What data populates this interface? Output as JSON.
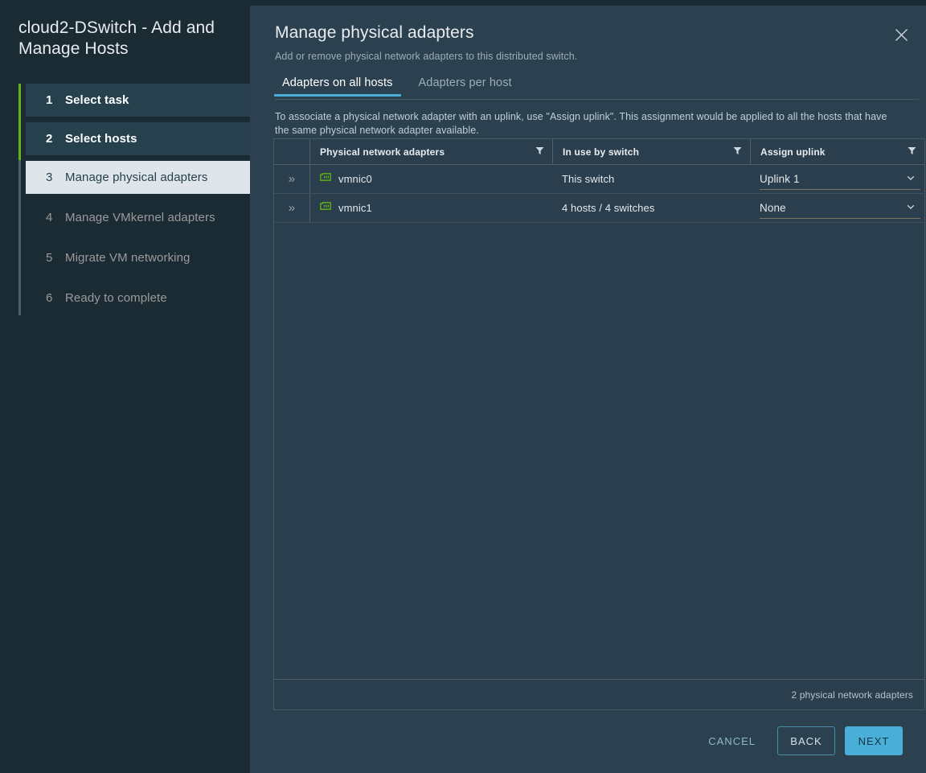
{
  "wizard": {
    "title": "cloud2-DSwitch - Add and Manage Hosts",
    "rail_done_color": "#60b515",
    "rail_color": "#4d5f6b",
    "steps": [
      {
        "num": "1",
        "label": "Select task",
        "state": "done"
      },
      {
        "num": "2",
        "label": "Select hosts",
        "state": "done"
      },
      {
        "num": "3",
        "label": "Manage physical adapters",
        "state": "current"
      },
      {
        "num": "4",
        "label": "Manage VMkernel adapters",
        "state": "pending"
      },
      {
        "num": "5",
        "label": "Migrate VM networking",
        "state": "pending"
      },
      {
        "num": "6",
        "label": "Ready to complete",
        "state": "pending"
      }
    ]
  },
  "panel": {
    "title": "Manage physical adapters",
    "subtitle": "Add or remove physical network adapters to this distributed switch.",
    "close_icon": "close-icon",
    "accent_color": "#49afd9",
    "tabs": [
      {
        "label": "Adapters on all hosts",
        "active": true
      },
      {
        "label": "Adapters per host",
        "active": false
      }
    ],
    "instructions": "To associate a physical network adapter with an uplink, use \"Assign uplink\". This assignment would be applied to all the hosts that have the same physical network adapter available."
  },
  "table": {
    "columns": [
      {
        "key": "handle",
        "label": "",
        "filter": false
      },
      {
        "key": "adapter",
        "label": "Physical network adapters",
        "filter": true
      },
      {
        "key": "inuse",
        "label": "In use by switch",
        "filter": true
      },
      {
        "key": "uplink",
        "label": "Assign uplink",
        "filter": true
      }
    ],
    "filter_icon": "filter-icon",
    "expand_icon": "double-chevron-right-icon",
    "adapter_icon": "network-adapter-icon",
    "adapter_icon_color": "#60b515",
    "rows": [
      {
        "handle": "»",
        "adapter": "vmnic0",
        "inuse": "This switch",
        "uplink": "Uplink 1"
      },
      {
        "handle": "»",
        "adapter": "vmnic1",
        "inuse": "4 hosts / 4 switches",
        "uplink": "None"
      }
    ],
    "footer_count": "2 physical network adapters"
  },
  "footer": {
    "cancel_label": "CANCEL",
    "back_label": "BACK",
    "next_label": "NEXT"
  }
}
